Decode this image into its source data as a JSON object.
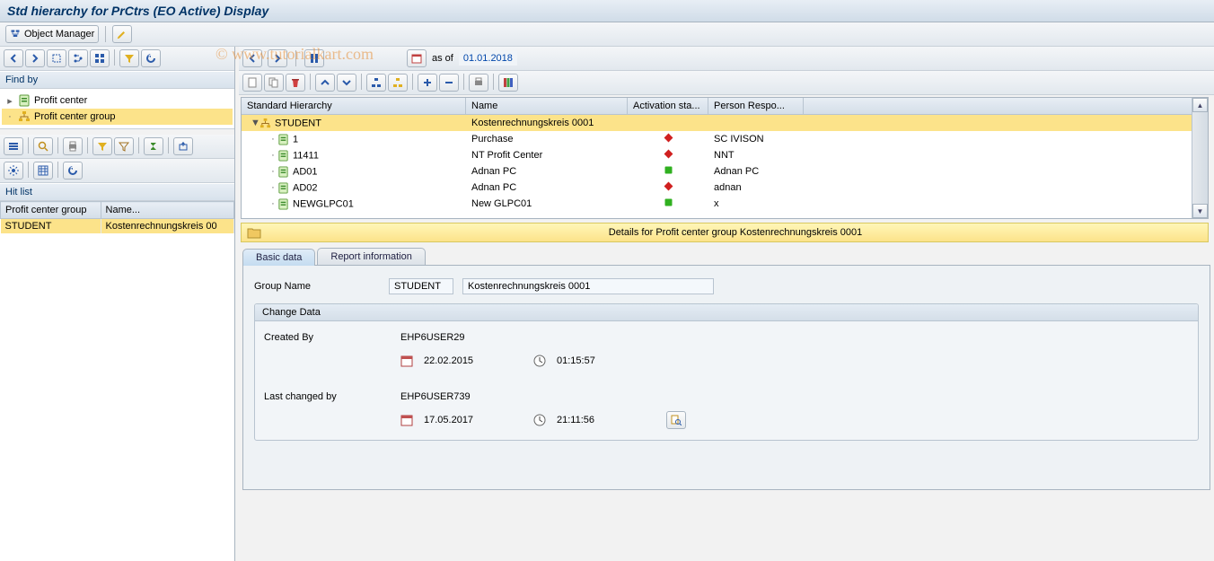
{
  "title": "Std hierarchy for PrCtrs (EO Active) Display",
  "watermark": "© www.tutorialkart.com",
  "toolbar": {
    "object_manager": "Object Manager"
  },
  "findby": {
    "header": "Find by",
    "items": [
      {
        "label": "Profit center"
      },
      {
        "label": "Profit center group"
      }
    ]
  },
  "hitlist": {
    "header": "Hit list",
    "col1": "Profit center group",
    "col2": "Name...",
    "rows": [
      {
        "c1": "STUDENT",
        "c2": "Kostenrechnungskreis 00"
      }
    ]
  },
  "right_toolbar": {
    "asof_label": "as of",
    "asof_date": "01.01.2018"
  },
  "grid": {
    "headers": {
      "c0": "Standard Hierarchy",
      "c1": "Name",
      "c2": "Activation sta...",
      "c3": "Person Respo..."
    },
    "rows": [
      {
        "indent": 0,
        "exp": "▼",
        "iconType": "group",
        "id": "STUDENT",
        "name": "Kostenrechnungskreis 0001",
        "status": "",
        "person": "",
        "selected": true
      },
      {
        "indent": 1,
        "exp": "·",
        "iconType": "pc",
        "id": "1",
        "name": "Purchase",
        "status": "red",
        "person": "SC IVISON"
      },
      {
        "indent": 1,
        "exp": "·",
        "iconType": "pc",
        "id": "11411",
        "name": "NT Profit Center",
        "status": "red",
        "person": "NNT"
      },
      {
        "indent": 1,
        "exp": "·",
        "iconType": "pc",
        "id": "AD01",
        "name": "Adnan PC",
        "status": "green",
        "person": "Adnan PC"
      },
      {
        "indent": 1,
        "exp": "·",
        "iconType": "pc",
        "id": "AD02",
        "name": "Adnan PC",
        "status": "red",
        "person": "adnan"
      },
      {
        "indent": 1,
        "exp": "·",
        "iconType": "pc",
        "id": "NEWGLPC01",
        "name": "New GLPC01",
        "status": "green",
        "person": "x"
      }
    ]
  },
  "detail_banner": "Details for Profit center group Kostenrechnungskreis 0001",
  "tabs": {
    "t1": "Basic data",
    "t2": "Report information"
  },
  "basic": {
    "group_name_label": "Group Name",
    "group_name": "STUDENT",
    "group_desc": "Kostenrechnungskreis 0001",
    "changedata_title": "Change Data",
    "created_by_label": "Created By",
    "created_by": "EHP6USER29",
    "created_date": "22.02.2015",
    "created_time": "01:15:57",
    "lastchg_label": "Last changed by",
    "lastchg_by": "EHP6USER739",
    "lastchg_date": "17.05.2017",
    "lastchg_time": "21:11:56"
  }
}
